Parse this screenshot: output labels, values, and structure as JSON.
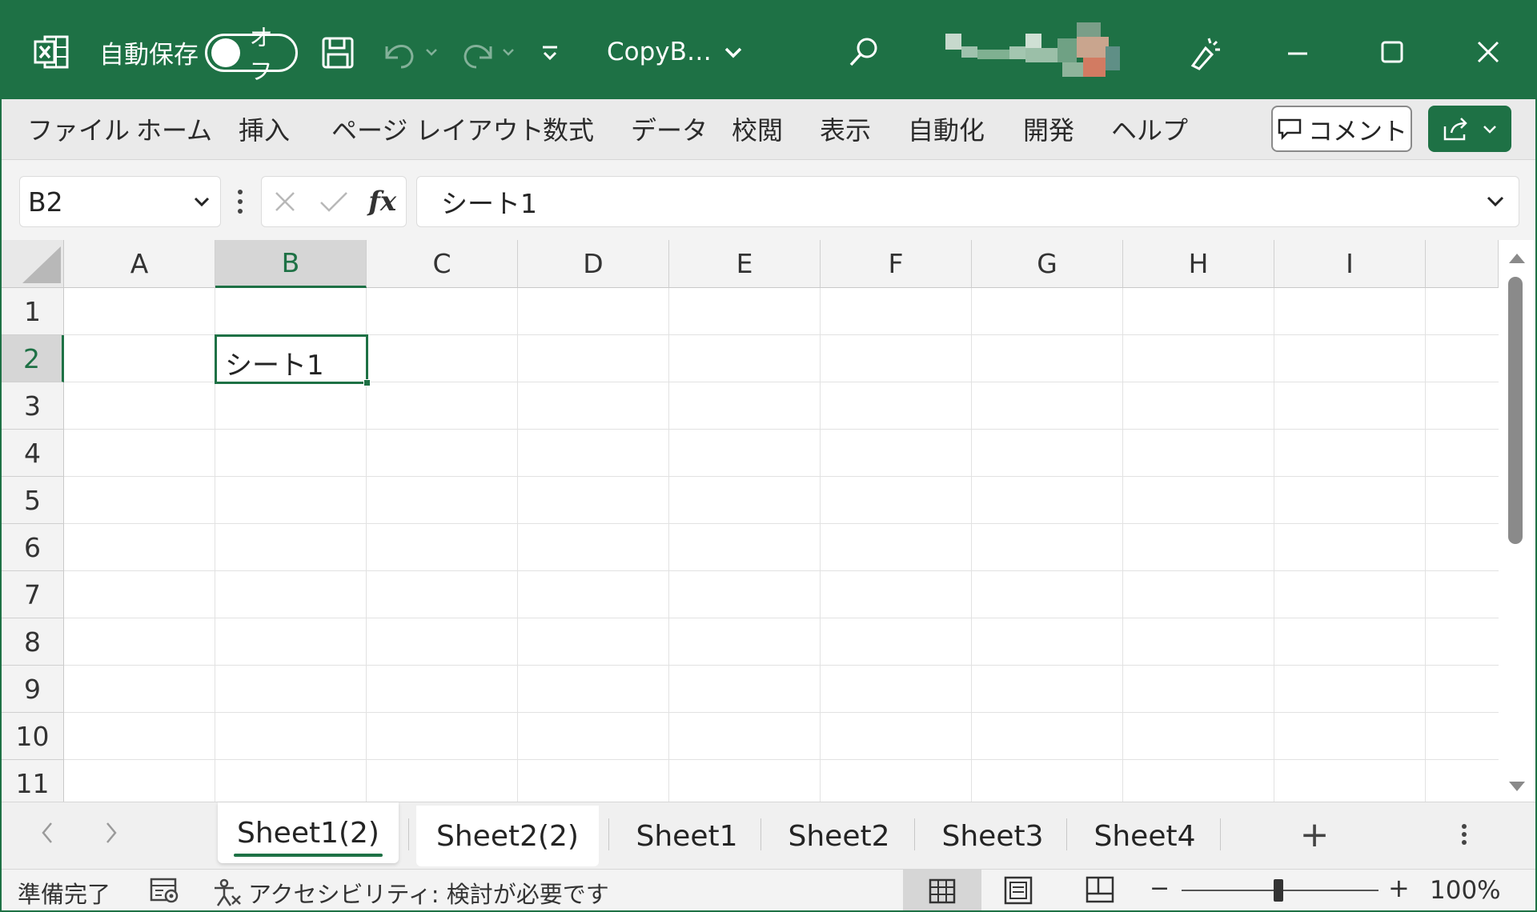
{
  "titlebar": {
    "autosave_label": "自動保存",
    "autosave_state": "オフ",
    "filename": "CopyB…",
    "accent": "#1e7145"
  },
  "ribbon": {
    "tabs": [
      "ファイル",
      "ホーム",
      "挿入",
      "ページ レイアウト",
      "数式",
      "データ",
      "校閲",
      "表示",
      "自動化",
      "開発",
      "ヘルプ"
    ],
    "comment_label": "コメント"
  },
  "formula_bar": {
    "name_box": "B2",
    "fx_label": "fx",
    "content": "シート1"
  },
  "grid": {
    "columns": [
      "A",
      "B",
      "C",
      "D",
      "E",
      "F",
      "G",
      "H",
      "I"
    ],
    "rows": [
      "1",
      "2",
      "3",
      "4",
      "5",
      "6",
      "7",
      "8",
      "9",
      "10",
      "11"
    ],
    "selected_column": "B",
    "selected_row": "2",
    "active_cell_value": "シート1"
  },
  "sheets": {
    "tabs": [
      "Sheet1(2)",
      "Sheet2(2)",
      "Sheet1",
      "Sheet2",
      "Sheet3",
      "Sheet4"
    ],
    "active": "Sheet1(2)",
    "add_label": "+"
  },
  "statusbar": {
    "ready": "準備完了",
    "accessibility": "アクセシビリティ: 検討が必要です",
    "zoom_minus": "−",
    "zoom_plus": "+",
    "zoom": "100%"
  }
}
